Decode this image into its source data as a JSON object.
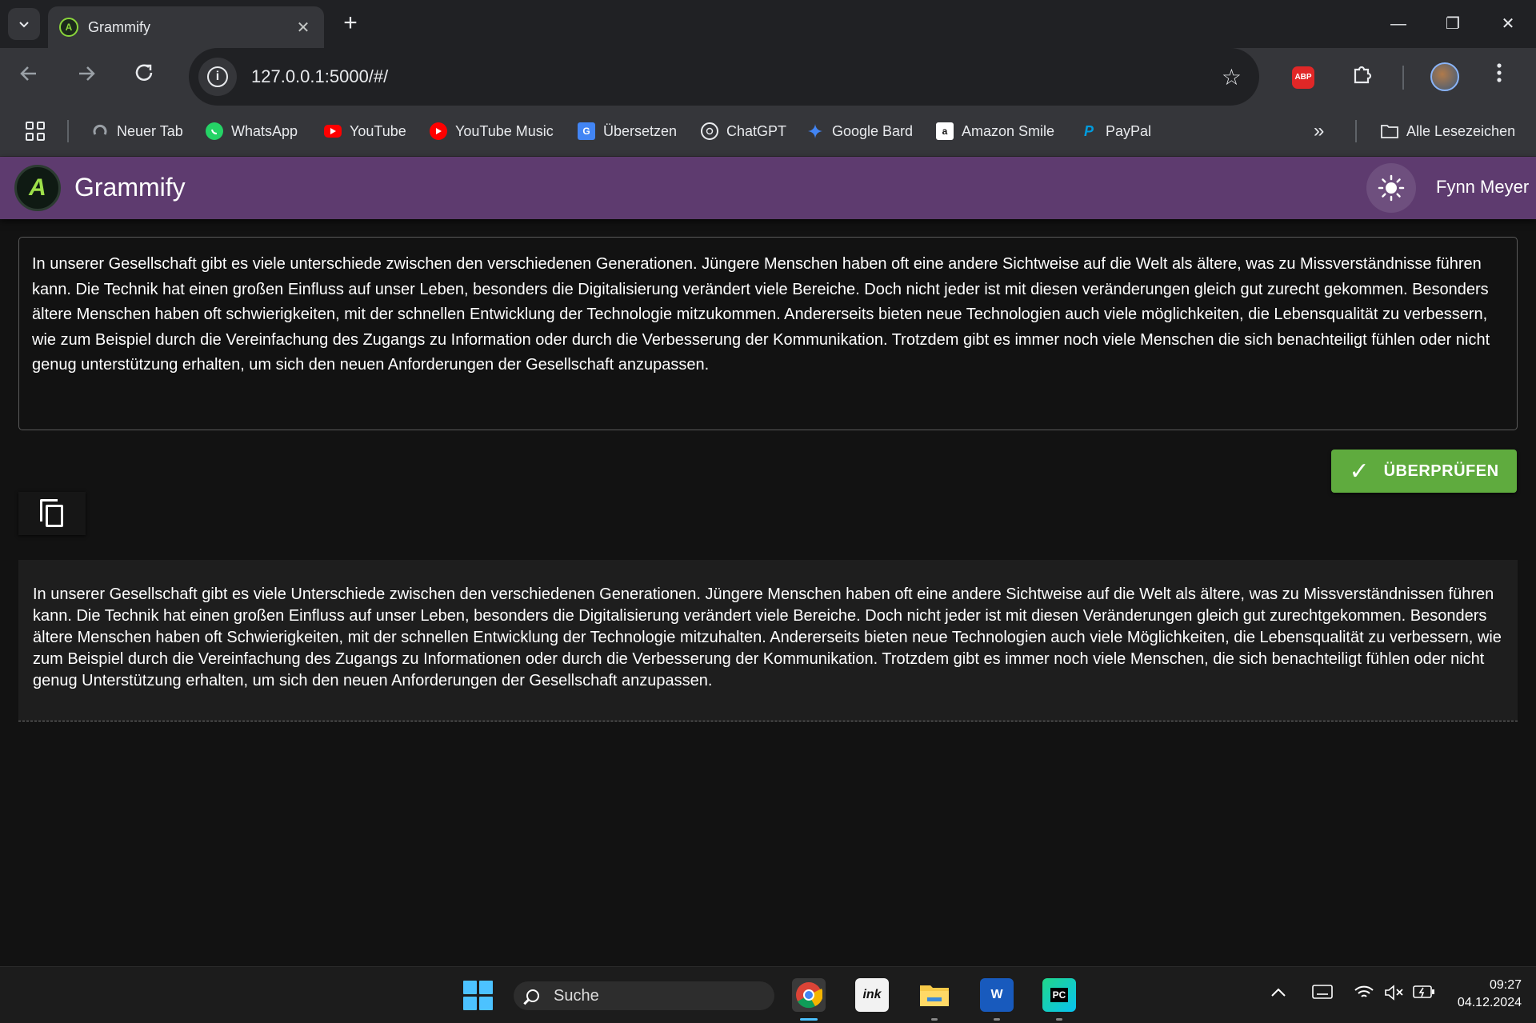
{
  "browser": {
    "tab_title": "Grammify",
    "tab_close": "✕",
    "new_tab": "+",
    "url": "127.0.0.1:5000/#/",
    "window_controls": {
      "minimize": "—",
      "restore": "❐",
      "close": "✕"
    },
    "extensions": {
      "adblock": "ABP"
    }
  },
  "bookmarks": {
    "items": [
      {
        "label": "Neuer Tab",
        "icon": "globe-icon",
        "color": "#9aa0a6"
      },
      {
        "label": "WhatsApp",
        "icon": "whatsapp-icon",
        "color": "#25d366"
      },
      {
        "label": "YouTube",
        "icon": "youtube-icon",
        "color": "#ff0000"
      },
      {
        "label": "YouTube Music",
        "icon": "youtube-music-icon",
        "color": "#ff0000"
      },
      {
        "label": "Übersetzen",
        "icon": "translate-icon",
        "color": "#4285f4"
      },
      {
        "label": "ChatGPT",
        "icon": "chatgpt-icon",
        "color": "#e8eaed"
      },
      {
        "label": "Google Bard",
        "icon": "bard-icon",
        "color": "#4285f4"
      },
      {
        "label": "Amazon Smile",
        "icon": "amazon-icon",
        "color": "#ffffff"
      },
      {
        "label": "PayPal",
        "icon": "paypal-icon",
        "color": "#009cde"
      }
    ],
    "more": "»",
    "all_bookmarks": "Alle Lesezeichen"
  },
  "app": {
    "title": "Grammify",
    "logo_glyph": "A",
    "user_name": "Fynn Meyer",
    "colors": {
      "header": "#5e3b6f",
      "check_button": "#5fab3e"
    }
  },
  "editor": {
    "input_text": "In unserer Gesellschaft gibt es viele unterschiede zwischen den verschiedenen Generationen. Jüngere Menschen haben oft eine andere Sichtweise auf die Welt als ältere, was zu Missverständnisse führen kann. Die Technik hat einen großen Einfluss auf unser Leben, besonders die Digitalisierung verändert viele Bereiche. Doch nicht jeder ist mit diesen veränderungen gleich gut zurecht gekommen. Besonders ältere Menschen haben oft schwierigkeiten, mit der schnellen Entwicklung der Technologie mitzukommen. Andererseits bieten neue Technologien auch viele möglichkeiten, die Lebensqualität zu verbessern, wie zum Beispiel durch die Vereinfachung des Zugangs zu Information oder durch die Verbesserung der Kommunikation. Trotzdem gibt es immer noch viele Menschen die sich benachteiligt fühlen oder nicht genug unterstützung erhalten, um sich den neuen Anforderungen der Gesellschaft anzupassen.",
    "check_label": "ÜBERPRÜFEN",
    "check_icon": "✓",
    "output_text": "In unserer Gesellschaft gibt es viele Unterschiede zwischen den verschiedenen Generationen. Jüngere Menschen haben oft eine andere Sichtweise auf die Welt als ältere, was zu Missverständnissen führen kann. Die Technik hat einen großen Einfluss auf unser Leben, besonders die Digitalisierung verändert viele Bereiche. Doch nicht jeder ist mit diesen Veränderungen gleich gut zurechtgekommen. Besonders ältere Menschen haben oft Schwierigkeiten, mit der schnellen Entwicklung der Technologie mitzuhalten. Andererseits bieten neue Technologien auch viele Möglichkeiten, die Lebensqualität zu verbessern, wie zum Beispiel durch die Vereinfachung des Zugangs zu Informationen oder durch die Verbesserung der Kommunikation. Trotzdem gibt es immer noch viele Menschen, die sich benachteiligt fühlen oder nicht genug Unterstützung erhalten, um sich den neuen Anforderungen der Gesellschaft anzupassen."
  },
  "taskbar": {
    "search_label": "Suche",
    "apps": [
      "chrome-icon",
      "inkscape-icon",
      "file-explorer-icon",
      "word-icon",
      "pycharm-icon"
    ],
    "time": "09:27",
    "date": "04.12.2024"
  }
}
